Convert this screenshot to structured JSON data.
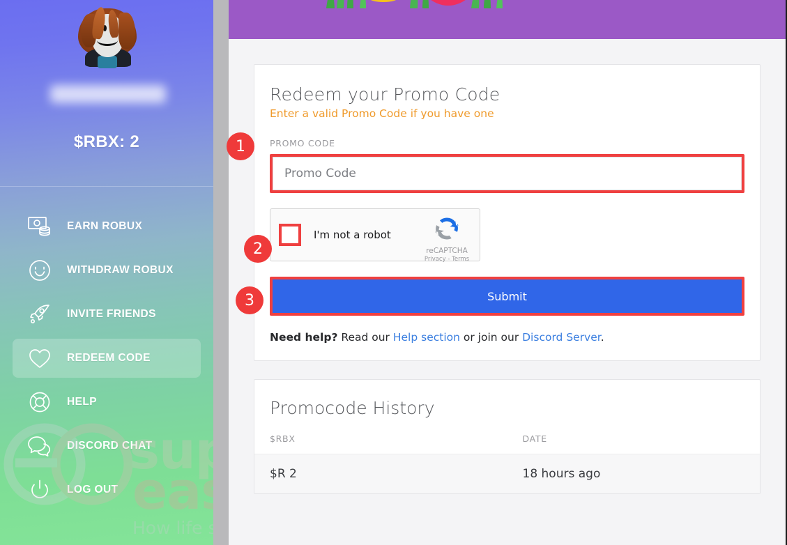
{
  "sidebar": {
    "avatar_alt": "roblox-avatar",
    "username_hidden": true,
    "balance": "$RBX: 2",
    "items": [
      {
        "label": "EARN ROBUX",
        "icon": "money-icon",
        "active": false
      },
      {
        "label": "WITHDRAW ROBUX",
        "icon": "smiley-icon",
        "active": false
      },
      {
        "label": "INVITE FRIENDS",
        "icon": "rocket-icon",
        "active": false
      },
      {
        "label": "REDEEM CODE",
        "icon": "heart-icon",
        "active": true
      },
      {
        "label": "HELP",
        "icon": "lifebuoy-icon",
        "active": false
      },
      {
        "label": "DISCORD CHAT",
        "icon": "chat-bubble-icon",
        "active": false
      },
      {
        "label": "LOG OUT",
        "icon": "power-icon",
        "active": false
      }
    ]
  },
  "watermark": {
    "word1": "super",
    "word2": "easy",
    "tagline": "How life should be"
  },
  "banner": {
    "background_color": "#9b59c6"
  },
  "redeem_card": {
    "title": "Redeem your Promo Code",
    "subtitle": "Enter a valid Promo Code if you have one",
    "field_label": "PROMO CODE",
    "input_placeholder": "Promo Code",
    "input_value": "",
    "submit_label": "Submit",
    "help": {
      "bold": "Need help?",
      "text1": " Read our ",
      "link1": "Help section",
      "text2": " or join our ",
      "link2": "Discord Server",
      "text3": "."
    }
  },
  "captcha": {
    "label": "I'm not a robot",
    "brand": "reCAPTCHA",
    "legal": "Privacy - Terms",
    "checked": false
  },
  "history_card": {
    "title": "Promocode History",
    "columns": [
      "$RBX",
      "DATE"
    ],
    "rows": [
      {
        "rbx": "$R 2",
        "date": "18 hours ago"
      }
    ]
  },
  "callouts": [
    {
      "number": "1"
    },
    {
      "number": "2"
    },
    {
      "number": "3"
    }
  ],
  "colors": {
    "accent_red": "#ef3a3a",
    "submit_blue": "#3066e8",
    "link_blue": "#3b7fe0",
    "subtitle_orange": "#ef9a2b",
    "banner_purple": "#9b59c6"
  }
}
